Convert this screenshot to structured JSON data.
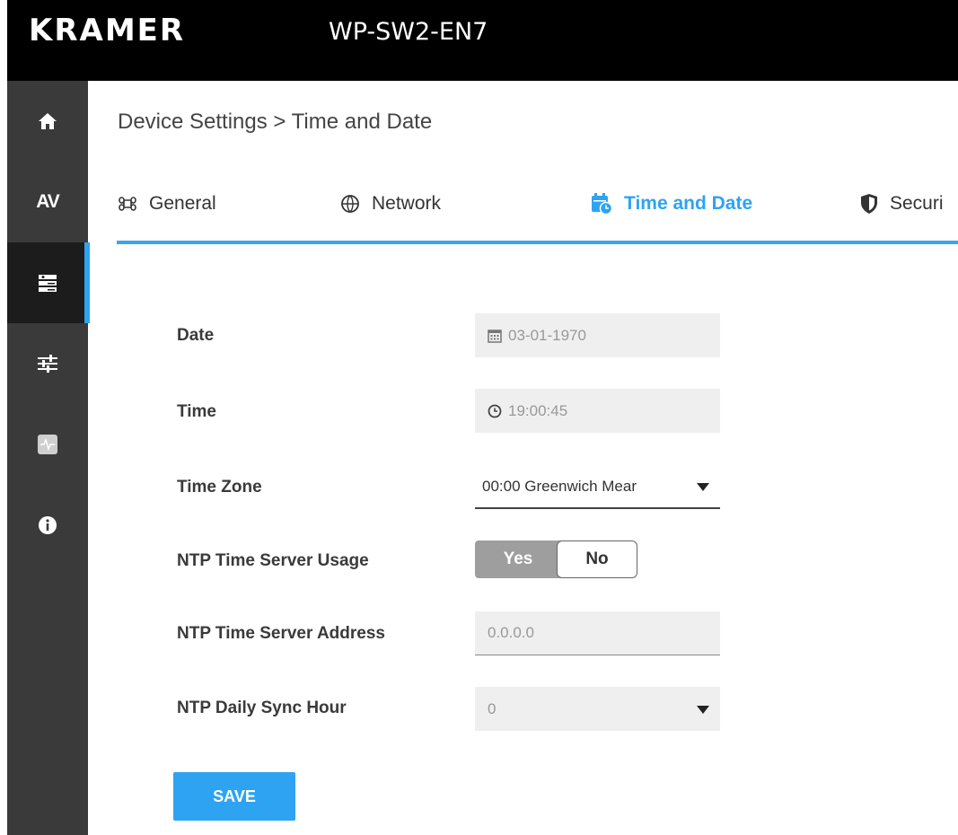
{
  "header": {
    "brand": "KRAMER",
    "model": "WP-SW2-EN7"
  },
  "sidebar": {
    "items": [
      {
        "icon": "home-icon",
        "label": ""
      },
      {
        "icon": "av-icon",
        "label": "AV"
      },
      {
        "icon": "device-settings-icon",
        "label": "",
        "active": true
      },
      {
        "icon": "sliders-icon",
        "label": ""
      },
      {
        "icon": "diagnostics-icon",
        "label": ""
      },
      {
        "icon": "info-icon",
        "label": ""
      }
    ]
  },
  "breadcrumb": "Device Settings > Time and Date",
  "tabs": [
    {
      "label": "General",
      "icon": "general-icon"
    },
    {
      "label": "Network",
      "icon": "network-icon"
    },
    {
      "label": "Time and Date",
      "icon": "calendar-clock-icon",
      "active": true
    },
    {
      "label": "Securi",
      "icon": "shield-icon"
    }
  ],
  "form": {
    "date": {
      "label": "Date",
      "value": "03-01-1970"
    },
    "time": {
      "label": "Time",
      "value": "19:00:45"
    },
    "time_zone": {
      "label": "Time Zone",
      "value": "00:00 Greenwich Mear"
    },
    "ntp_usage": {
      "label": "NTP Time Server Usage",
      "yes": "Yes",
      "no": "No",
      "selected": "No"
    },
    "ntp_address": {
      "label": "NTP Time Server Address",
      "value": "0.0.0.0"
    },
    "ntp_sync_hour": {
      "label": "NTP Daily Sync Hour",
      "value": "0"
    }
  },
  "save_label": "SAVE",
  "colors": {
    "accent": "#2ea3f2",
    "header": "#000000",
    "sidebar": "#3a3a3a"
  }
}
